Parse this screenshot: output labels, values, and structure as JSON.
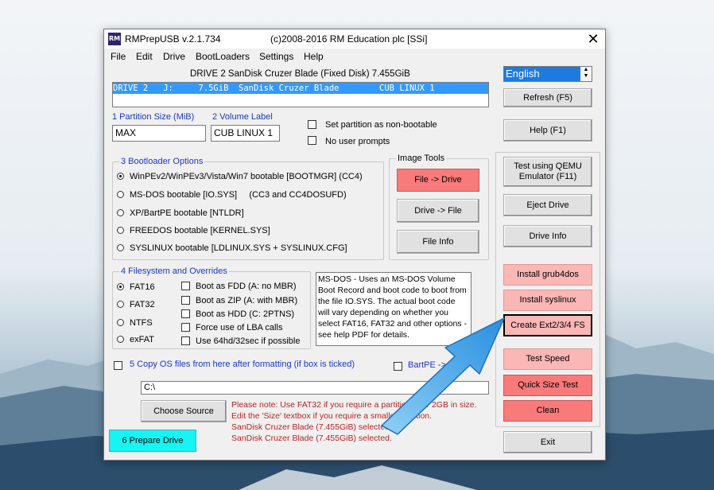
{
  "window": {
    "app_icon": "RM",
    "title": "RMPrepUSB v.2.1.734",
    "copyright": "(c)2008-2016 RM Education plc [SSi]",
    "close": "✕"
  },
  "menu": [
    "File",
    "Edit",
    "Drive",
    "BootLoaders",
    "Settings",
    "Help"
  ],
  "drive_header": "DRIVE 2 SanDisk Cruzer Blade  (Fixed Disk) 7.455GiB",
  "drive_list": {
    "selected_row": "DRIVE 2   J:     7.5GiB  SanDisk Cruzer Blade        CUB LINUX 1"
  },
  "language": {
    "value": "English",
    "spin_up": "▲",
    "spin_down": "▼"
  },
  "buttons": {
    "refresh": "Refresh (F5)",
    "help": "Help (F1)",
    "test_qemu_1": "Test using QEMU",
    "test_qemu_2": "Emulator (F11)",
    "eject": "Eject Drive",
    "drive_info": "Drive Info",
    "install_grub4dos": "Install grub4dos",
    "install_syslinux": "Install syslinux",
    "create_ext": "Create Ext2/3/4 FS",
    "test_speed": "Test Speed",
    "quick_size": "Quick Size Test",
    "clean": "Clean",
    "exit": "Exit",
    "file_to_drive": "File -> Drive",
    "drive_to_file": "Drive -> File",
    "file_info": "File Info",
    "choose_source": "Choose Source",
    "prepare_drive": "6 Prepare Drive"
  },
  "partition": {
    "label": "1 Partition Size (MiB)",
    "value": "MAX"
  },
  "volume": {
    "label": "2 Volume Label",
    "value": "CUB LINUX 1"
  },
  "checkboxes": {
    "non_bootable": "Set partition as non-bootable",
    "no_prompts": "No user prompts",
    "copy_os": "5 Copy OS files from here after formatting (if box is ticked)",
    "bartpe": "BartPE ->"
  },
  "image_tools_title": "Image Tools",
  "bootloader": {
    "title": "3 Bootloader Options",
    "options": [
      "WinPEv2/WinPEv3/Vista/Win7 bootable [BOOTMGR] (CC4)",
      "MS-DOS bootable [IO.SYS]     (CC3 and CC4DOSUFD)",
      "XP/BartPE bootable [NTLDR]",
      "FREEDOS bootable [KERNEL.SYS]",
      "SYSLINUX bootable [LDLINUX.SYS + SYSLINUX.CFG]"
    ],
    "selected": 0
  },
  "filesystem": {
    "title": "4 Filesystem and Overrides",
    "options": [
      "FAT16",
      "FAT32",
      "NTFS",
      "exFAT"
    ],
    "selected": 0,
    "overrides": [
      "Boot as FDD (A: no MBR)",
      "Boot as ZIP (A: with MBR)",
      "Boot as HDD (C: 2PTNS)",
      "Force use of LBA calls",
      "Use 64hd/32sec if possible"
    ]
  },
  "info_text": "MS-DOS - Uses an MS-DOS Volume Boot Record and boot code to boot from the file IO.SYS. The actual boot code will vary depending on whether you select FAT16, FAT32 and other options - see help PDF for details.",
  "source_path": "C:\\",
  "notes": [
    "Please note: Use FAT32 if you require a partition over 2GB in size.",
    "Edit the 'Size' textbox if you require a smaller partition.",
    "SanDisk Cruzer Blade (7.455GiB) selected.",
    "SanDisk Cruzer Blade (7.455GiB) selected."
  ],
  "colors": {
    "selection_blue": "#3399ff",
    "red_button": "#f87a7a",
    "pink_button": "#fbb6b6",
    "cyan_button": "#16f4f4",
    "arrow": "#2e9be6",
    "note_red": "#c02020"
  }
}
